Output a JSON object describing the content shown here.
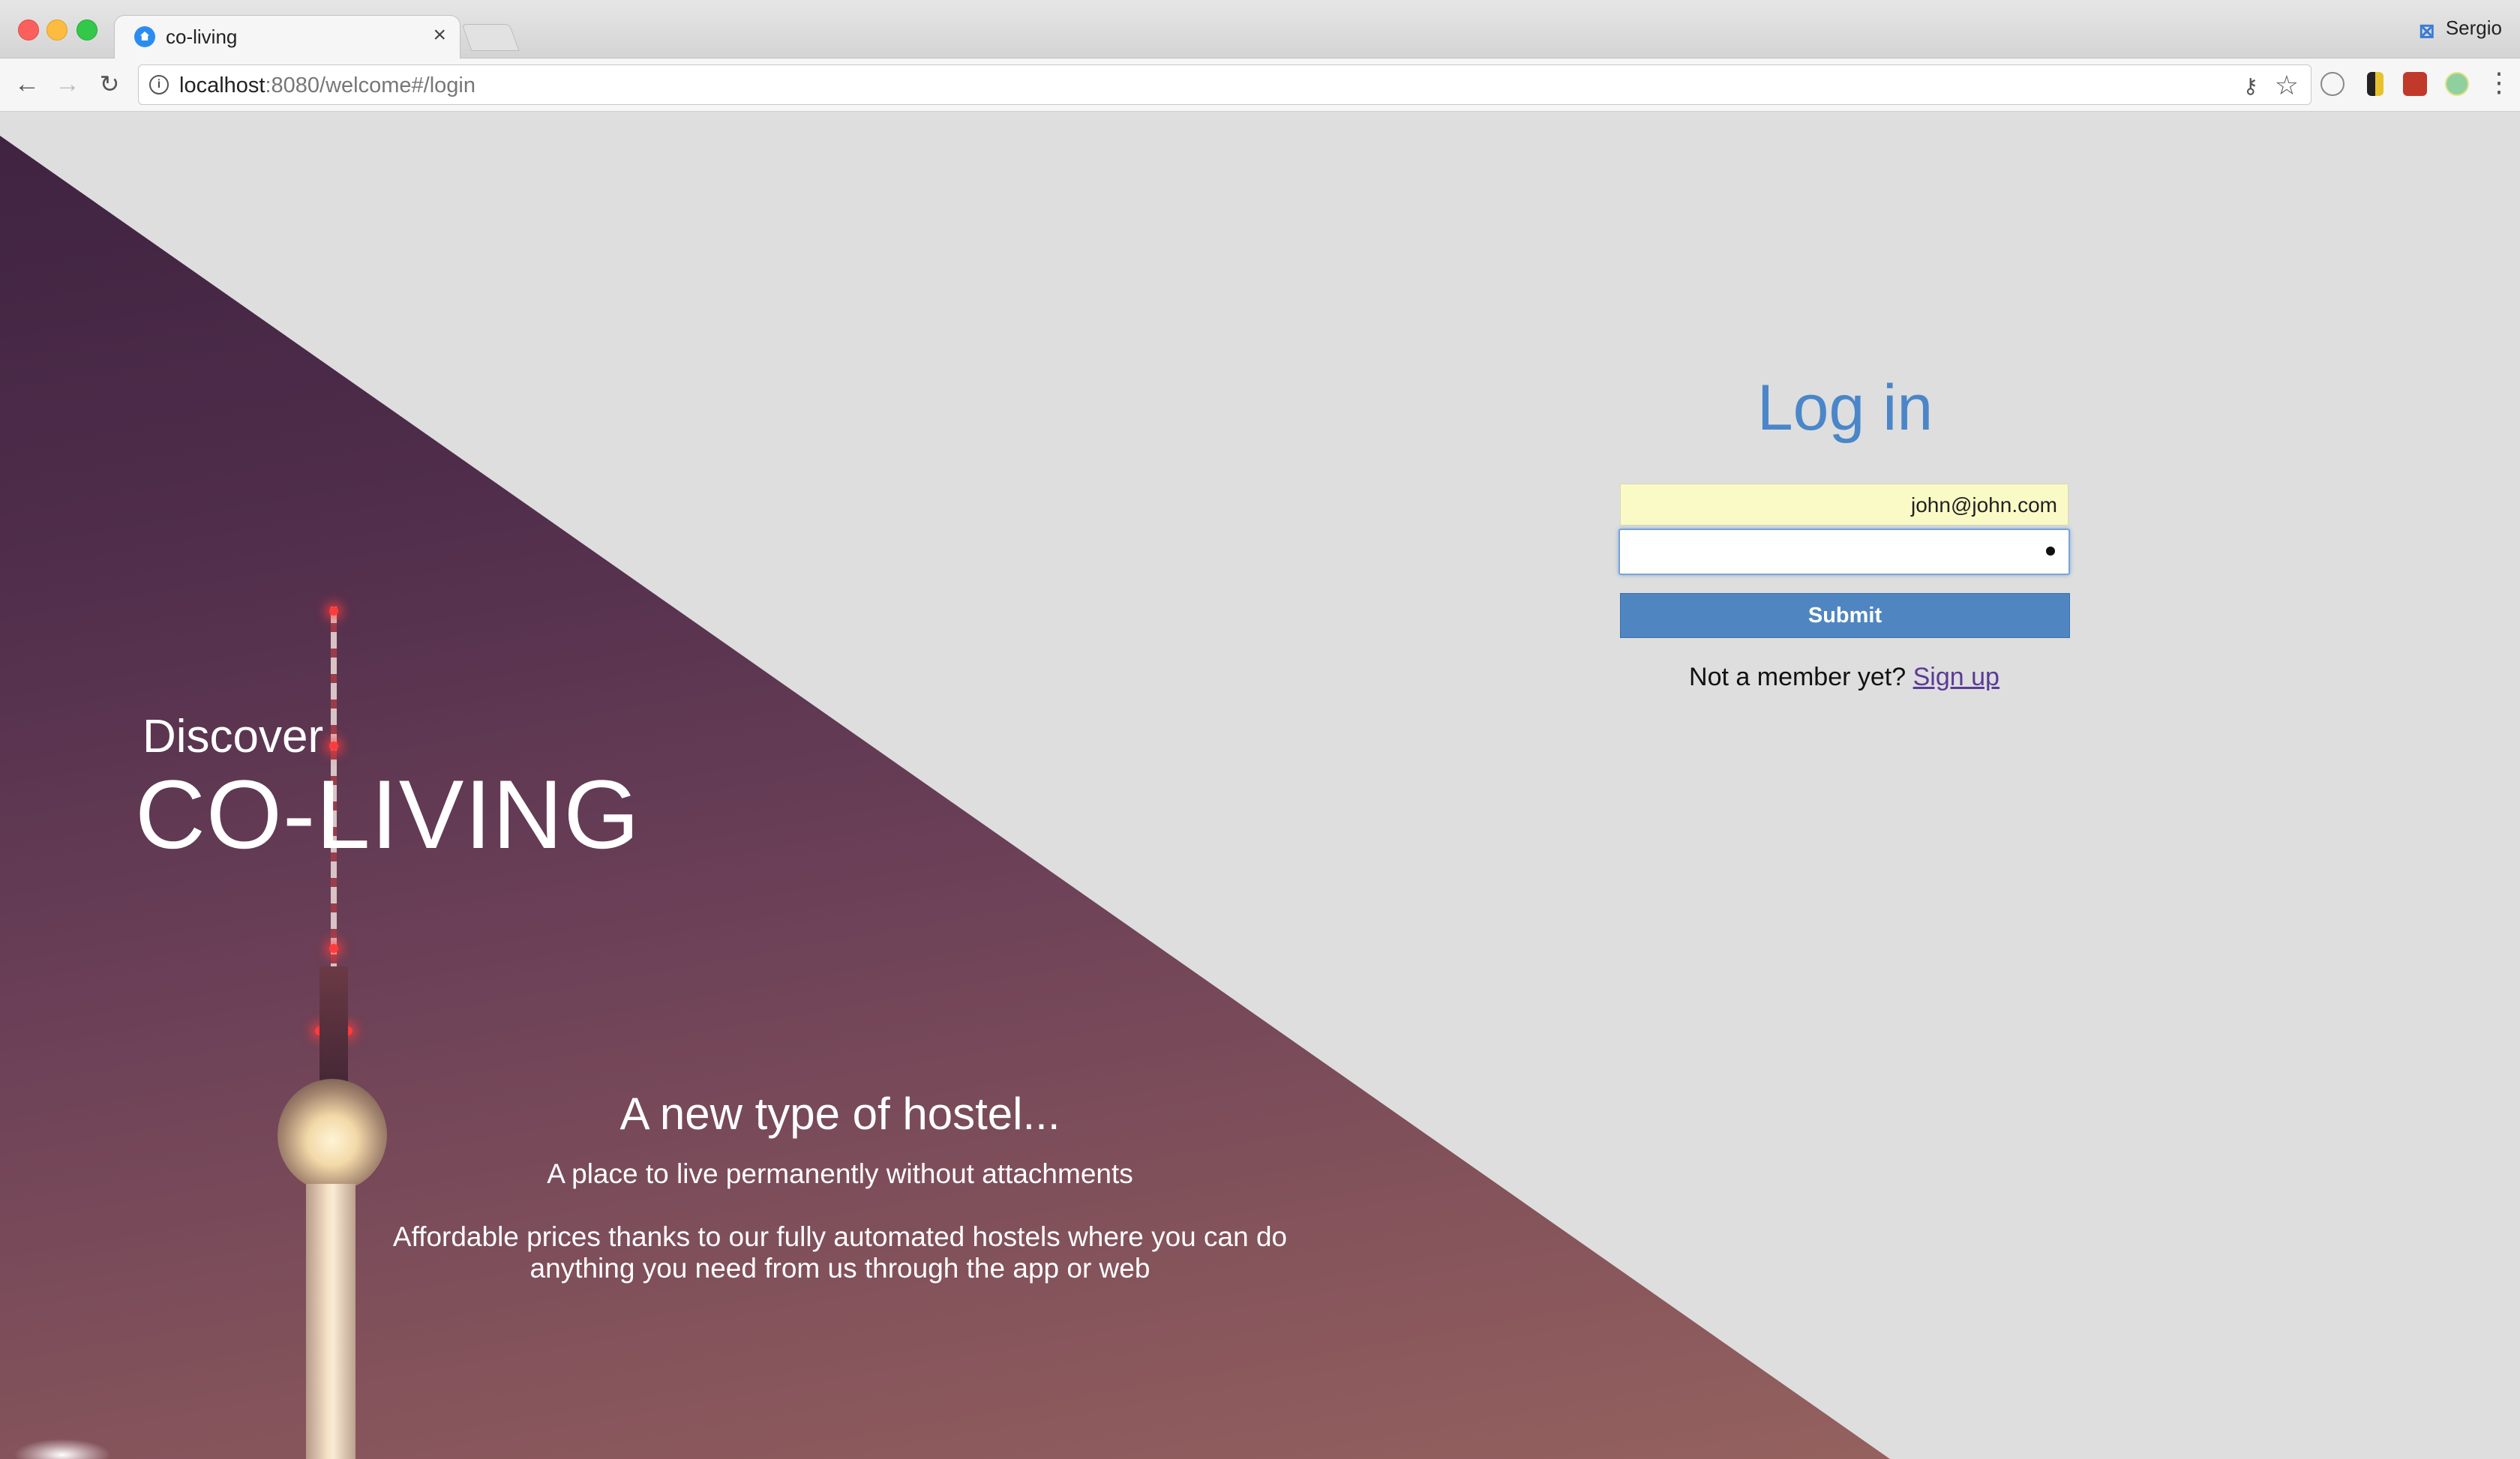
{
  "browser": {
    "tab_title": "co-living",
    "tab_close": "×",
    "profile_name": "Sergio",
    "url_host": "localhost",
    "url_path": ":8080/welcome#/login",
    "icons": [
      "back-arrow-icon",
      "forward-arrow-icon",
      "reload-icon",
      "info-icon",
      "key-icon",
      "star-icon",
      "menu-dots-icon"
    ]
  },
  "hero": {
    "discover": "Discover",
    "brand": "CO-LIVING",
    "tagline_title": "A new type of hostel...",
    "tagline_sub": "A place to live permanently without attachments",
    "tagline_desc": "Affordable prices thanks to our fully automated hostels where you can do anything you need from us through the app or web"
  },
  "login": {
    "title": "Log in",
    "email_value": "john@john.com",
    "submit_label": "Submit",
    "signup_prompt": "Not a member yet?",
    "signup_link": "Sign up"
  },
  "colors": {
    "accent": "#4f86c2",
    "title_blue": "#4a86c8",
    "autofill": "#fafac6",
    "link": "#5b3a97"
  }
}
